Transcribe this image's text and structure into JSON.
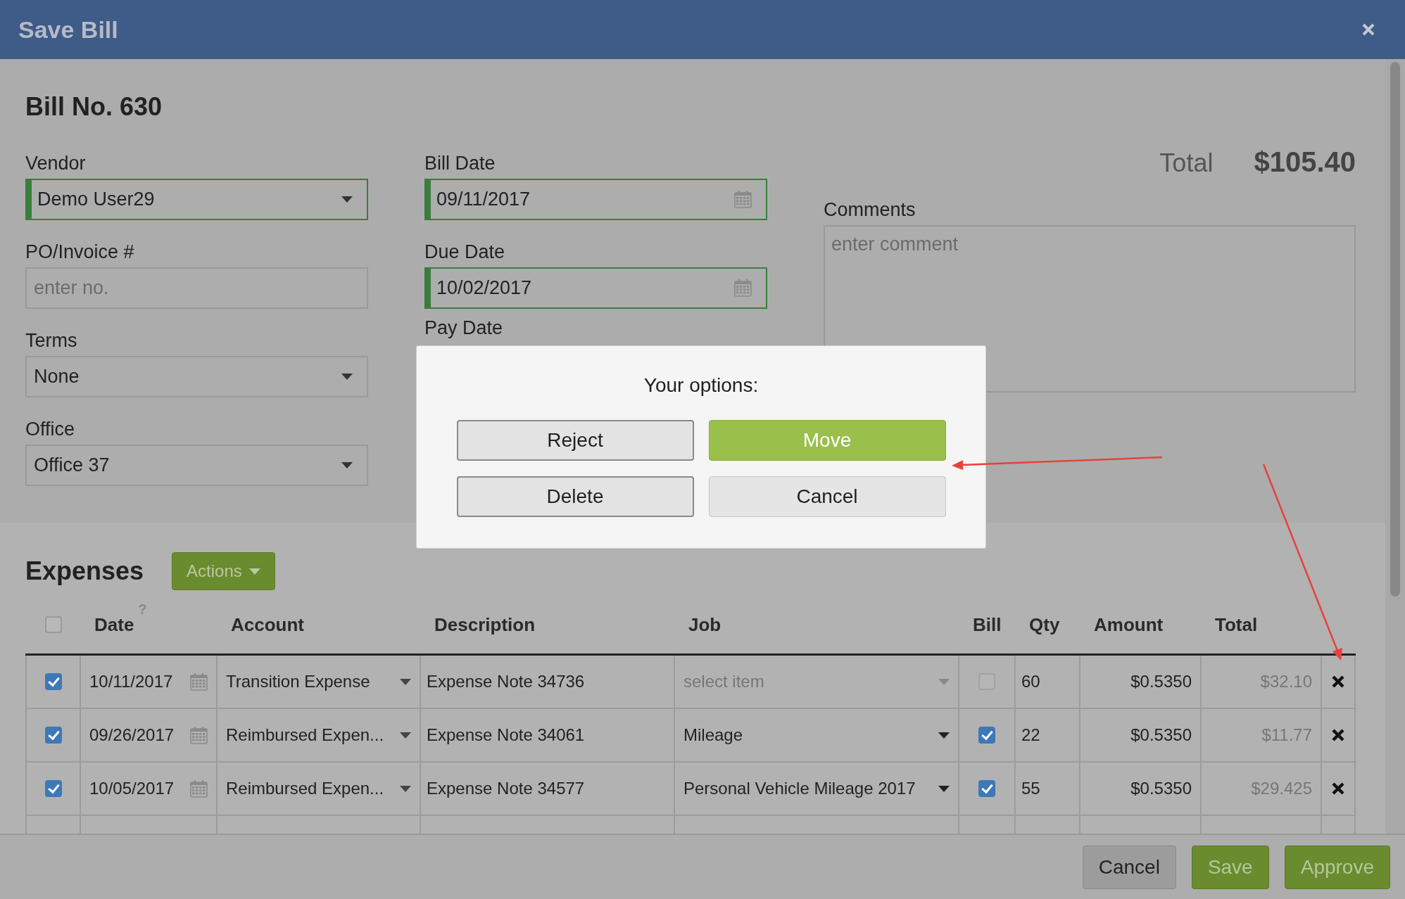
{
  "window": {
    "title": "Save Bill"
  },
  "bill": {
    "title": "Bill No. 630"
  },
  "form": {
    "columns": [
      [
        {
          "label": "Vendor",
          "kind": "select",
          "value": "Demo User29",
          "validated": true
        },
        {
          "label": "PO/Invoice #",
          "kind": "text",
          "placeholder": "enter no.",
          "validated": false
        },
        {
          "label": "Terms",
          "kind": "select",
          "value": "None",
          "validated": false
        },
        {
          "label": "Office",
          "kind": "select",
          "value": "Office 37",
          "validated": false
        }
      ],
      [
        {
          "label": "Bill Date",
          "kind": "date",
          "value": "09/11/2017",
          "validated": true
        },
        {
          "label": "Due Date",
          "kind": "date",
          "value": "10/02/2017",
          "validated": true
        },
        {
          "label": "Pay Date",
          "kind": "label"
        }
      ]
    ],
    "total": {
      "label": "Total",
      "value": "$105.40"
    },
    "comments": {
      "label": "Comments",
      "placeholder": "enter comment"
    }
  },
  "dialog": {
    "title": "Your options:",
    "buttons": [
      {
        "label": "Reject",
        "kind": "outlined"
      },
      {
        "label": "Move",
        "kind": "primary"
      },
      {
        "label": "Delete",
        "kind": "outlined"
      },
      {
        "label": "Cancel",
        "kind": "plain"
      }
    ]
  },
  "expenses": {
    "title": "Expenses",
    "actions": "Actions",
    "select_all": {
      "checked": false
    },
    "columns": [
      {
        "label": "Date",
        "help": "?"
      },
      {
        "label": "Account"
      },
      {
        "label": "Description"
      },
      {
        "label": "Job"
      },
      {
        "label": "Bill"
      },
      {
        "label": "Qty"
      },
      {
        "label": "Amount"
      },
      {
        "label": "Total"
      }
    ],
    "rows": [
      {
        "checked": true,
        "date": "10/11/2017",
        "account": "Transition Expense",
        "description": "Expense Note 34736",
        "job": {
          "placeholder": "select item"
        },
        "bill": false,
        "qty": "60",
        "amount": "$0.5350",
        "total": "$32.10"
      },
      {
        "checked": true,
        "date": "09/26/2017",
        "account": "Reimbursed Expen...",
        "description": "Expense Note 34061",
        "job": {
          "value": "Mileage"
        },
        "bill": true,
        "qty": "22",
        "amount": "$0.5350",
        "total": "$11.77"
      },
      {
        "checked": true,
        "date": "10/05/2017",
        "account": "Reimbursed Expen...",
        "description": "Expense Note 34577",
        "job": {
          "value": "Personal Vehicle Mileage 2017"
        },
        "bill": true,
        "qty": "55",
        "amount": "$0.5350",
        "total": "$29.425"
      }
    ]
  },
  "footer": {
    "buttons": [
      {
        "label": "Cancel",
        "kind": "default"
      },
      {
        "label": "Save",
        "kind": "success"
      },
      {
        "label": "Approve",
        "kind": "success"
      }
    ]
  }
}
